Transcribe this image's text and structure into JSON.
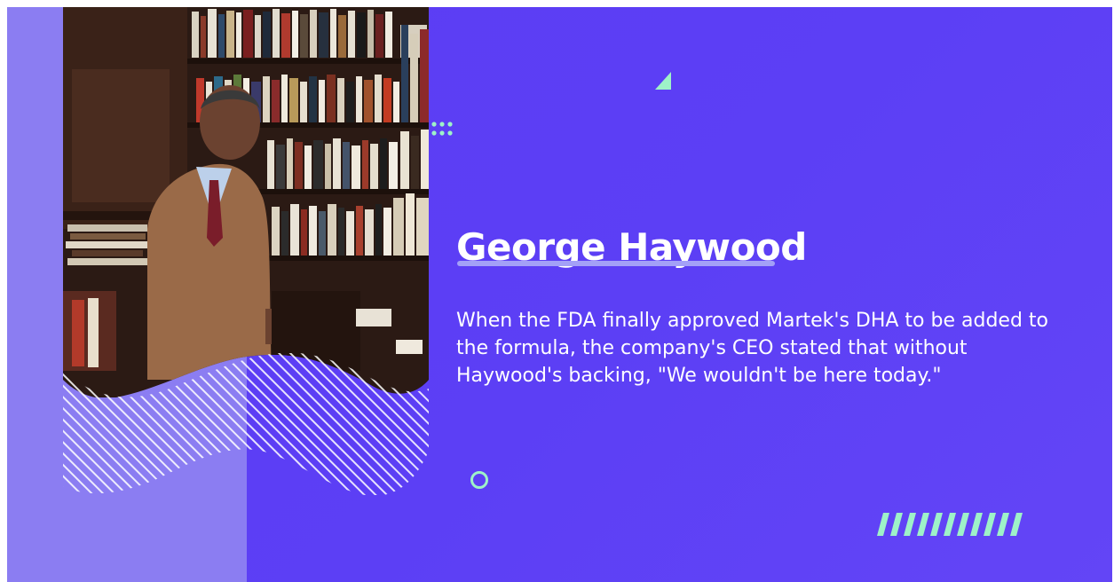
{
  "slide": {
    "name": "George Haywood",
    "quote": "When the FDA finally approved Martek's DHA to be added to the formula, the company's CEO stated that without Haywood's backing, \"We wouldn't be here today.\""
  },
  "colors": {
    "background": "#5b3cf4",
    "left_panel": "#8b7df2",
    "accent_mint": "#9ef2c8",
    "rule": "#a3a0f7",
    "text": "#ffffff"
  },
  "icons": {
    "photo": "portrait-in-library-photo",
    "triangle": "triangle-decoration",
    "dots": "dot-grid-decoration",
    "ring": "ring-decoration",
    "stripes": "slash-stripes-decoration"
  }
}
